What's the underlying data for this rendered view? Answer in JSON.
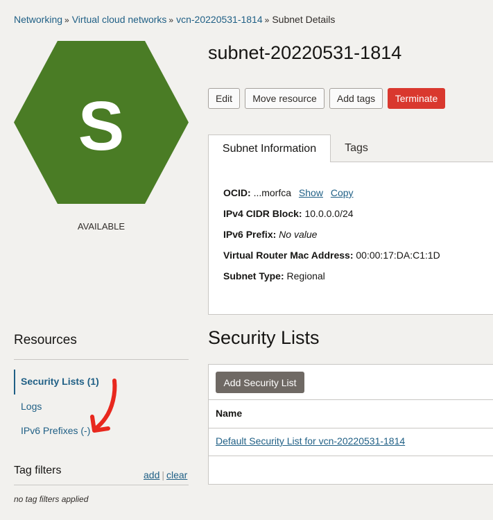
{
  "breadcrumb": {
    "items": [
      "Networking",
      "Virtual cloud networks",
      "vcn-20220531-1814"
    ],
    "current": "Subnet Details",
    "separator": "»"
  },
  "resource_icon": {
    "letter": "S",
    "color": "#4a7c25",
    "icon_name": "subnet-hexagon-icon"
  },
  "status": "AVAILABLE",
  "title": "subnet-20220531-1814",
  "actions": {
    "edit": "Edit",
    "move": "Move resource",
    "add_tags": "Add tags",
    "terminate": "Terminate"
  },
  "tabs": {
    "info": "Subnet Information",
    "tags": "Tags",
    "active": "Subnet Information"
  },
  "details": {
    "ocid_label": "OCID:",
    "ocid_value": "...morfca",
    "show": "Show",
    "copy": "Copy",
    "ipv4_label": "IPv4 CIDR Block:",
    "ipv4_value": "10.0.0.0/24",
    "ipv6_label": "IPv6 Prefix:",
    "ipv6_value": "No value",
    "mac_label": "Virtual Router Mac Address:",
    "mac_value": "00:00:17:DA:C1:1D",
    "type_label": "Subnet Type:",
    "type_value": "Regional"
  },
  "sidebar": {
    "resources_heading": "Resources",
    "items": [
      {
        "label": "Security Lists (1)",
        "active": true
      },
      {
        "label": "Logs",
        "active": false
      },
      {
        "label": "IPv6 Prefixes (-)",
        "active": false
      }
    ],
    "tag_filters_heading": "Tag filters",
    "add": "add",
    "pipe": "|",
    "clear": "clear",
    "no_filters": "no tag filters applied"
  },
  "security_lists": {
    "title": "Security Lists",
    "add_button": "Add Security List",
    "column_name": "Name",
    "rows": [
      "Default Security List for vcn-20220531-1814"
    ]
  },
  "colors": {
    "link": "#1f5f85",
    "danger": "#d9382e",
    "hexagon": "#4a7c25",
    "annotation": "#e8281e",
    "secondary_button": "#6f6964"
  }
}
